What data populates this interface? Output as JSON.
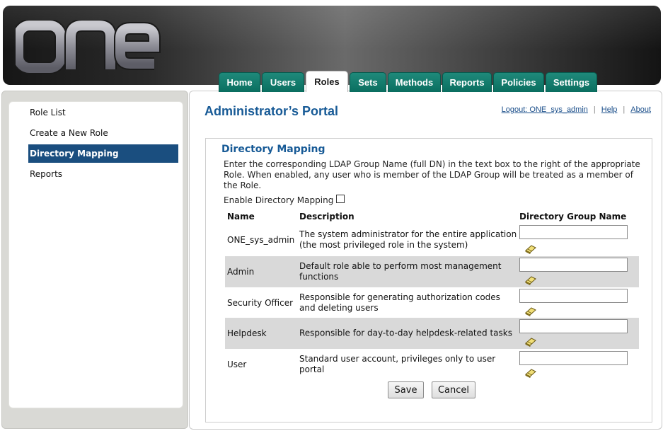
{
  "header": {
    "logo_text": "one"
  },
  "tabs": [
    {
      "label": "Home",
      "active": false
    },
    {
      "label": "Users",
      "active": false
    },
    {
      "label": "Roles",
      "active": true
    },
    {
      "label": "Sets",
      "active": false
    },
    {
      "label": "Methods",
      "active": false
    },
    {
      "label": "Reports",
      "active": false
    },
    {
      "label": "Policies",
      "active": false
    },
    {
      "label": "Settings",
      "active": false
    }
  ],
  "sidebar": {
    "items": [
      {
        "label": "Role List",
        "active": false
      },
      {
        "label": "Create a New Role",
        "active": false
      },
      {
        "label": "Directory Mapping",
        "active": true
      },
      {
        "label": "Reports",
        "active": false
      }
    ]
  },
  "main": {
    "title": "Administrator’s Portal",
    "links": {
      "logout": "Logout: ONE_sys_admin",
      "help": "Help",
      "about": "About"
    },
    "section_title": "Directory Mapping",
    "intro": "Enter the corresponding LDAP Group Name (full DN) in the text box to the right of the appropriate Role.   When enabled, any user who is member of the LDAP Group will be treated as a member of the Role.",
    "enable_label": "Enable Directory Mapping",
    "enable_checked": false,
    "table": {
      "headers": {
        "name": "Name",
        "description": "Description",
        "group": "Directory Group Name"
      },
      "rows": [
        {
          "name": "ONE_sys_admin",
          "description": "The system administrator for the entire application (the most privileged role in the system)",
          "group_value": ""
        },
        {
          "name": "Admin",
          "description": "Default role able to perform most management functions",
          "group_value": ""
        },
        {
          "name": "Security Officer",
          "description": "Responsible for generating authorization codes and deleting users",
          "group_value": ""
        },
        {
          "name": "Helpdesk",
          "description": "Responsible for day-to-day helpdesk-related tasks",
          "group_value": ""
        },
        {
          "name": "User",
          "description": "Standard user account, privileges only to user portal",
          "group_value": ""
        }
      ]
    },
    "buttons": {
      "save": "Save",
      "cancel": "Cancel"
    }
  },
  "colors": {
    "tab_teal": "#0a6e60",
    "title_blue": "#175a96",
    "sidebar_active": "#1a4e7f",
    "row_shade": "#d9d9d9"
  },
  "icons": {
    "row_action": "eraser-icon"
  }
}
